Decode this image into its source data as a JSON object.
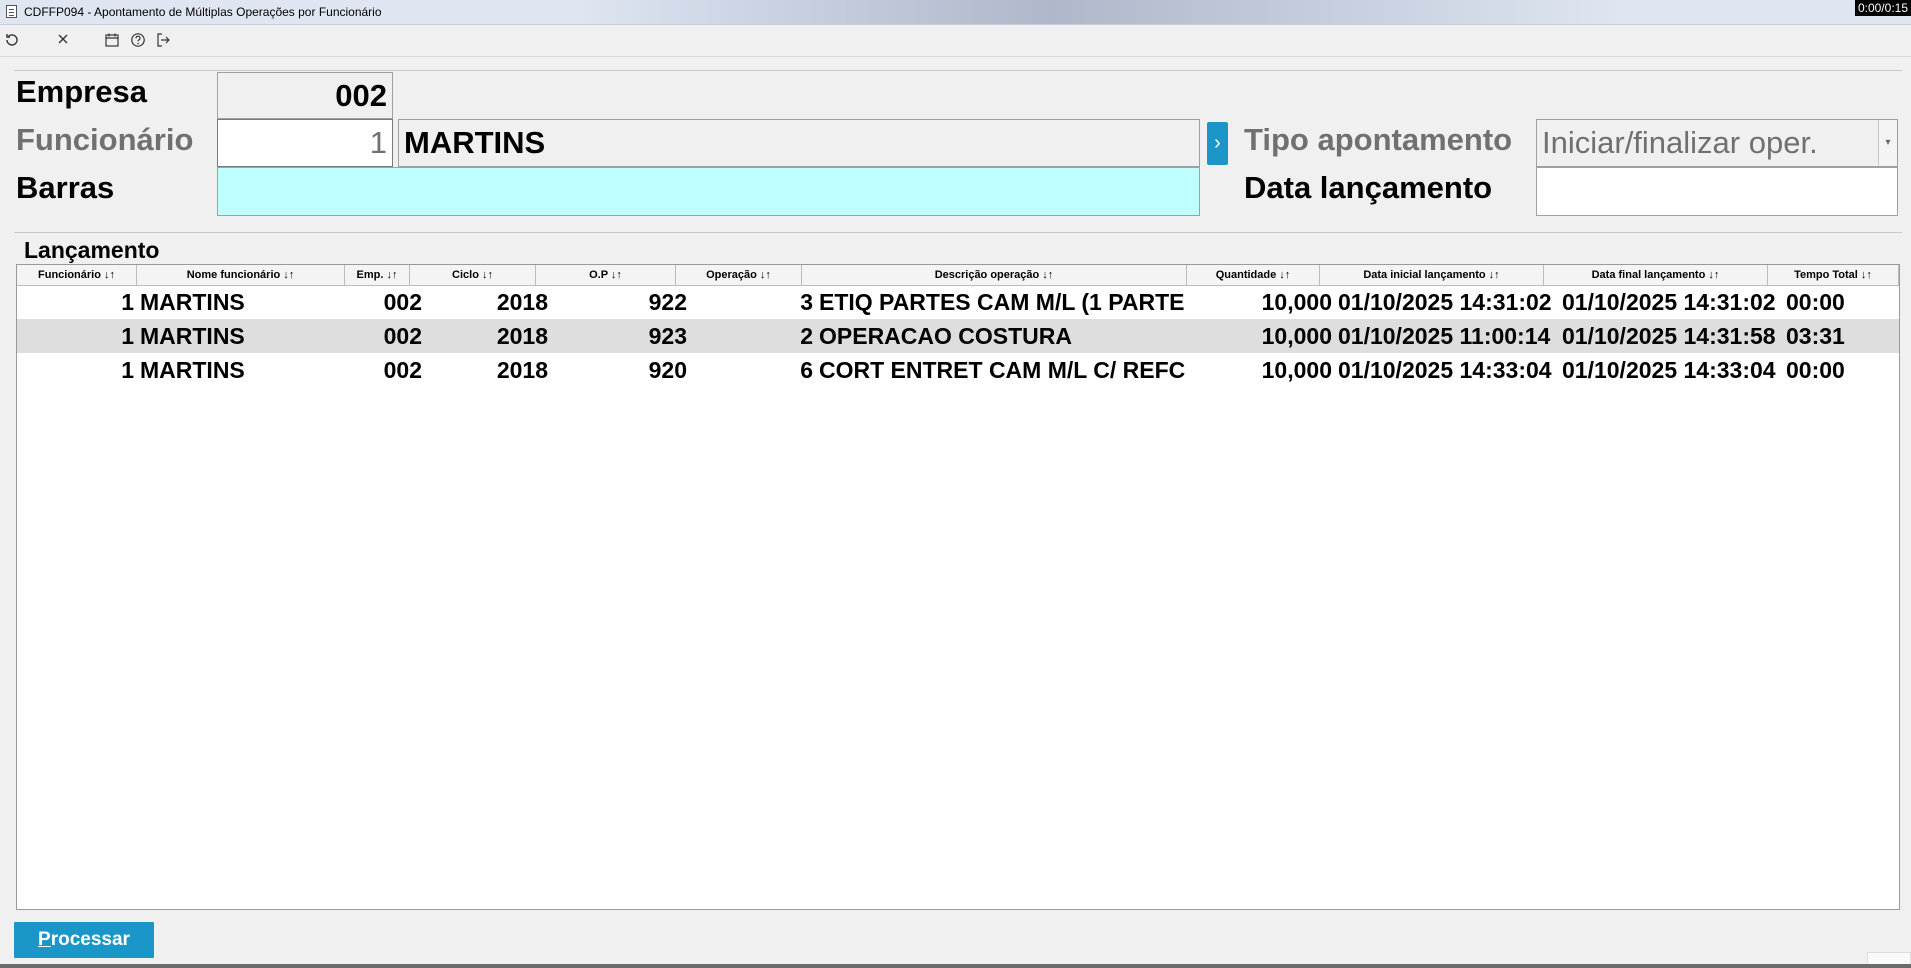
{
  "window": {
    "title": "CDFFP094 - Apontamento de Múltiplas Operações por Funcionário",
    "timer": "0:00/0:15"
  },
  "toolbar": {
    "icons": [
      "refresh-icon",
      "close-icon",
      "calendar-icon",
      "help-icon",
      "exit-icon"
    ]
  },
  "form": {
    "empresa_label": "Empresa",
    "empresa_value": "002",
    "funcionario_label": "Funcionário",
    "funcionario_code": "1",
    "funcionario_name": "MARTINS",
    "lookup_glyph": "›",
    "barras_label": "Barras",
    "barras_value": "",
    "tipo_label": "Tipo apontamento",
    "tipo_value": "Iniciar/finalizar oper.",
    "data_label": "Data lançamento",
    "data_value": ""
  },
  "grid": {
    "section_title": "Lançamento",
    "columns": [
      "Funcionário ↓↑",
      "Nome funcionário ↓↑",
      "Emp. ↓↑",
      "Ciclo ↓↑",
      "O.P ↓↑",
      "Operação ↓↑",
      "Descrição operação ↓↑",
      "Quantidade ↓↑",
      "Data inicial lançamento ↓↑",
      "Data final lançamento ↓↑",
      "Tempo Total ↓↑"
    ],
    "rows": [
      [
        "1",
        "MARTINS",
        "002",
        "2018",
        "922",
        "3",
        "ETIQ PARTES CAM M/L (1 PARTE",
        "10,000",
        "01/10/2025 14:31:02",
        "01/10/2025 14:31:02",
        "00:00"
      ],
      [
        "1",
        "MARTINS",
        "002",
        "2018",
        "923",
        "2",
        "OPERACAO COSTURA",
        "10,000",
        "01/10/2025 11:00:14",
        "01/10/2025 14:31:58",
        "03:31"
      ],
      [
        "1",
        "MARTINS",
        "002",
        "2018",
        "920",
        "6",
        "CORT ENTRET CAM M/L C/ REFC",
        "10,000",
        "01/10/2025 14:33:04",
        "01/10/2025 14:33:04",
        "00:00"
      ]
    ]
  },
  "actions": {
    "processar_first": "P",
    "processar_rest": "rocessar"
  }
}
